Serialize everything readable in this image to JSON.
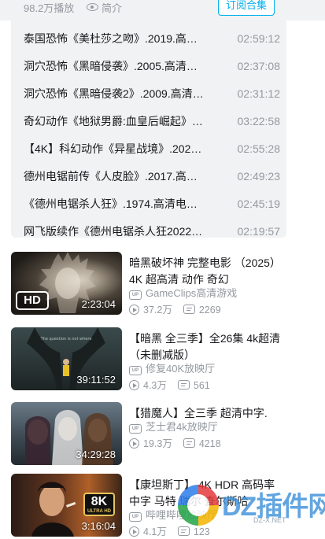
{
  "header": {
    "plays": "98.2万播放",
    "intro_label": "简介",
    "subscribe_label": "订阅合集"
  },
  "episodes": [
    {
      "title": "泰国恐怖《美杜莎之吻》.2019.高…",
      "duration": "02:59:12"
    },
    {
      "title": "洞穴恐怖《黑暗侵袭》.2005.高清…",
      "duration": "02:37:08"
    },
    {
      "title": "洞穴恐怖《黑暗侵袭2》.2009.高清…",
      "duration": "02:31:12"
    },
    {
      "title": "奇幻动作《地狱男爵:血皇后崛起》…",
      "duration": "03:22:58"
    },
    {
      "title": "【4K】科幻动作《异星战境》.202…",
      "duration": "02:55:28"
    },
    {
      "title": "德州电锯前传《人皮脸》.2017.高…",
      "duration": "02:49:23"
    },
    {
      "title": "《德州电锯杀人狂》.1974.高清电…",
      "duration": "02:45:19"
    },
    {
      "title": "网飞版续作《德州电锯杀人狂2022…",
      "duration": "02:19:57"
    }
  ],
  "videos": [
    {
      "title": "暗黑破坏神 完整电影 （2025）4K 超高清 动作 奇幻",
      "duration": "2:23:04",
      "badge": "HD",
      "uploader": "GameClips高清游戏",
      "views": "37.2万",
      "danmaku": "2269"
    },
    {
      "title": "【暗黑 全三季】全26集 4k超清（未删减版）",
      "duration": "39:11:52",
      "uploader": "修复40K放映厅",
      "views": "4.3万",
      "danmaku": "561"
    },
    {
      "title": "【猎魔人】全三季 超清中字.",
      "duration": "34:29:28",
      "uploader": "芝士君4k放映厅",
      "views": "19.3万",
      "danmaku": "4218"
    },
    {
      "title": "【康坦斯丁】 4K HDR 高码率 中字 马特 瑞尔 查尔斯哈",
      "duration": "3:16:04",
      "badge_main": "8K",
      "badge_sub": "ULTRA HD",
      "uploader": "哔哩哔哩放映厅",
      "views": "4.1万",
      "danmaku": "123"
    }
  ],
  "icons": {
    "up": "UP",
    "play_count": "play-circle-icon",
    "danmaku": "danmaku-icon",
    "eye": "eye-icon"
  },
  "watermark": {
    "text": "DZ插件网",
    "sub": "DZ-X.NET"
  },
  "colors": {
    "accent": "#00aeec",
    "muted": "#9499a0",
    "panel_bg": "#f1f2f3"
  }
}
